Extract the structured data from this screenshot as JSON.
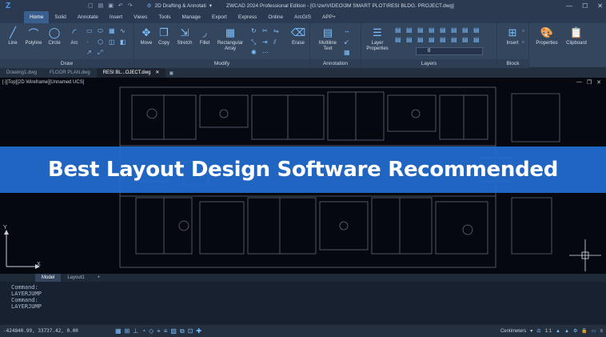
{
  "titlebar": {
    "workspace": "2D Drafting & Annotati",
    "title": "ZWCAD 2024 Professional Edition - [G:\\zw\\VIDEO\\3M SMART PLOT\\RESI BLDG. PROJECT.dwg]",
    "minimize": "—",
    "maximize": "☐",
    "close": "✕"
  },
  "menu": {
    "tabs": [
      "Home",
      "Solid",
      "Annotate",
      "Insert",
      "Views",
      "Tools",
      "Manage",
      "Export",
      "Express",
      "Online",
      "ArcGIS",
      "APP+"
    ]
  },
  "ribbon": {
    "panels": {
      "draw": "Draw",
      "modify": "Modify",
      "annotation": "Annotation",
      "layers": "Layers",
      "block": "Block"
    },
    "tools": {
      "line": "Line",
      "polyline": "Polyline",
      "circle": "Circle",
      "arc": "Arc",
      "move": "Move",
      "copy": "Copy",
      "stretch": "Stretch",
      "fillet": "Fillet",
      "rect_array_1": "Rectangular",
      "rect_array_2": "Array",
      "erase": "Erase",
      "mtext_1": "Multiline",
      "mtext_2": "Text",
      "layer_props_1": "Layer",
      "layer_props_2": "Properties",
      "insert": "Insert",
      "properties": "Properties",
      "clipboard": "Clipboard"
    },
    "layer_value": "0"
  },
  "doctabs": [
    {
      "label": "Drawing1.dwg",
      "active": false
    },
    {
      "label": "FLOOR PLAN.dwg",
      "active": false
    },
    {
      "label": "RESI BL...OJECT.dwg",
      "active": true
    }
  ],
  "viewport": {
    "label": "[-][Top][2D Wireframe][Unnamed UCS]",
    "banner": "Best Layout Design Software Recommended",
    "axis_x": "X",
    "axis_y": "Y"
  },
  "layout_tabs": [
    "Model",
    "Layout1",
    "+"
  ],
  "command_history": [
    "Command:",
    "LAYERJUMP",
    "Command:",
    "LAYERJUMP"
  ],
  "status": {
    "coords": "-424840.99, 33737.42, 0.00",
    "units": "Centimeters",
    "scale": "1:1"
  }
}
